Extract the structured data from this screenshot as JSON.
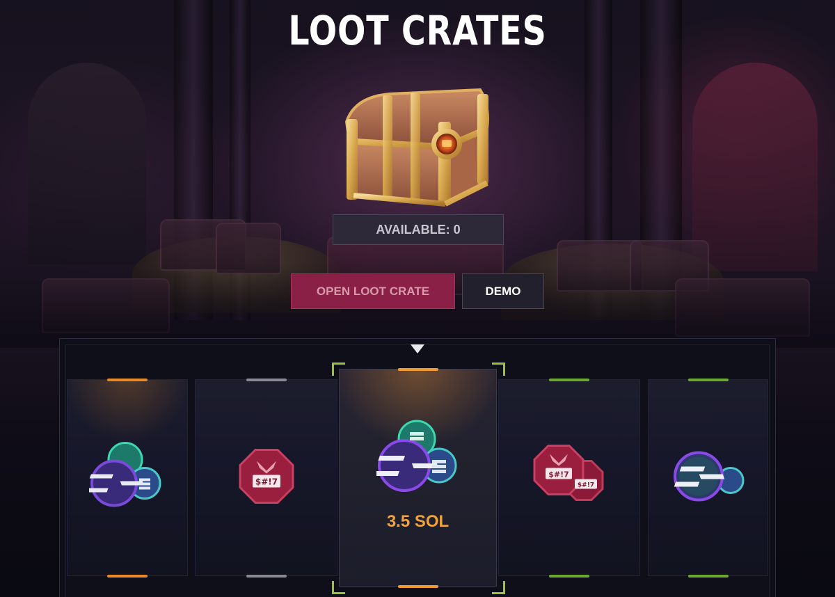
{
  "page": {
    "title": "LOOT CRATES"
  },
  "crate": {
    "available_label": "AVAILABLE: 0"
  },
  "actions": {
    "open_label": "OPEN LOOT CRATE",
    "demo_label": "DEMO"
  },
  "reel": {
    "items": [
      {
        "type": "sol-coins",
        "rarity_color": "#e88a2a"
      },
      {
        "type": "token-badge",
        "rarity_color": "#8a8a96"
      },
      {
        "type": "sol-coins",
        "rarity_color": "#f09a30",
        "label": "3.5 SOL",
        "selected": true
      },
      {
        "type": "token-badges",
        "rarity_color": "#6aa832"
      },
      {
        "type": "sol-coin",
        "rarity_color": "#6aa832"
      }
    ],
    "badge_text": "$#!7"
  },
  "colors": {
    "accent_pink": "#8a2046",
    "prize_orange": "#f0a23c",
    "bracket_green": "#9bc23c"
  }
}
